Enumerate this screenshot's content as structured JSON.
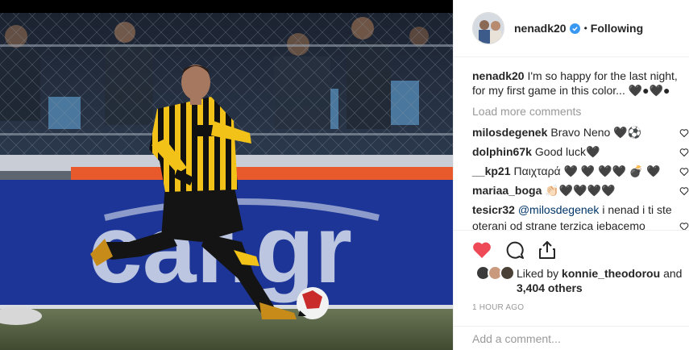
{
  "header": {
    "username": "nenadk20",
    "separator": "•",
    "follow_status": "Following"
  },
  "caption": {
    "username": "nenadk20",
    "text": "I'm so happy for the last night, for my first game in this color... 🖤●🖤●"
  },
  "load_more": "Load more comments",
  "comments": [
    {
      "username": "milosdegenek",
      "text": "Bravo Neno 🖤⚽"
    },
    {
      "username": "dolphin67k",
      "text": "Good luck🖤"
    },
    {
      "username": "__kp21",
      "text": "Παιχταρά 🖤 🖤 🖤🖤 💣 🖤"
    },
    {
      "username": "mariaa_boga",
      "text": "👏🏻🖤🖤🖤🖤"
    }
  ],
  "last_comment": {
    "username": "tesicr32",
    "mention": "@milosdegenek",
    "text": "i nenad i ti ste oterani od strane terzica jebacemo"
  },
  "likes": {
    "prefix": "Liked by",
    "user": "konnie_theodorou",
    "middle": "and",
    "count": "3,404 others"
  },
  "timestamp": "1 HOUR AGO",
  "add_comment": {
    "placeholder": "Add a comment..."
  },
  "photo": {
    "banner_text": "car.gr",
    "kit_color": "#f2c218"
  },
  "colors": {
    "like_red": "#ed4956",
    "verified_blue": "#3897f0",
    "muted": "#999999"
  }
}
